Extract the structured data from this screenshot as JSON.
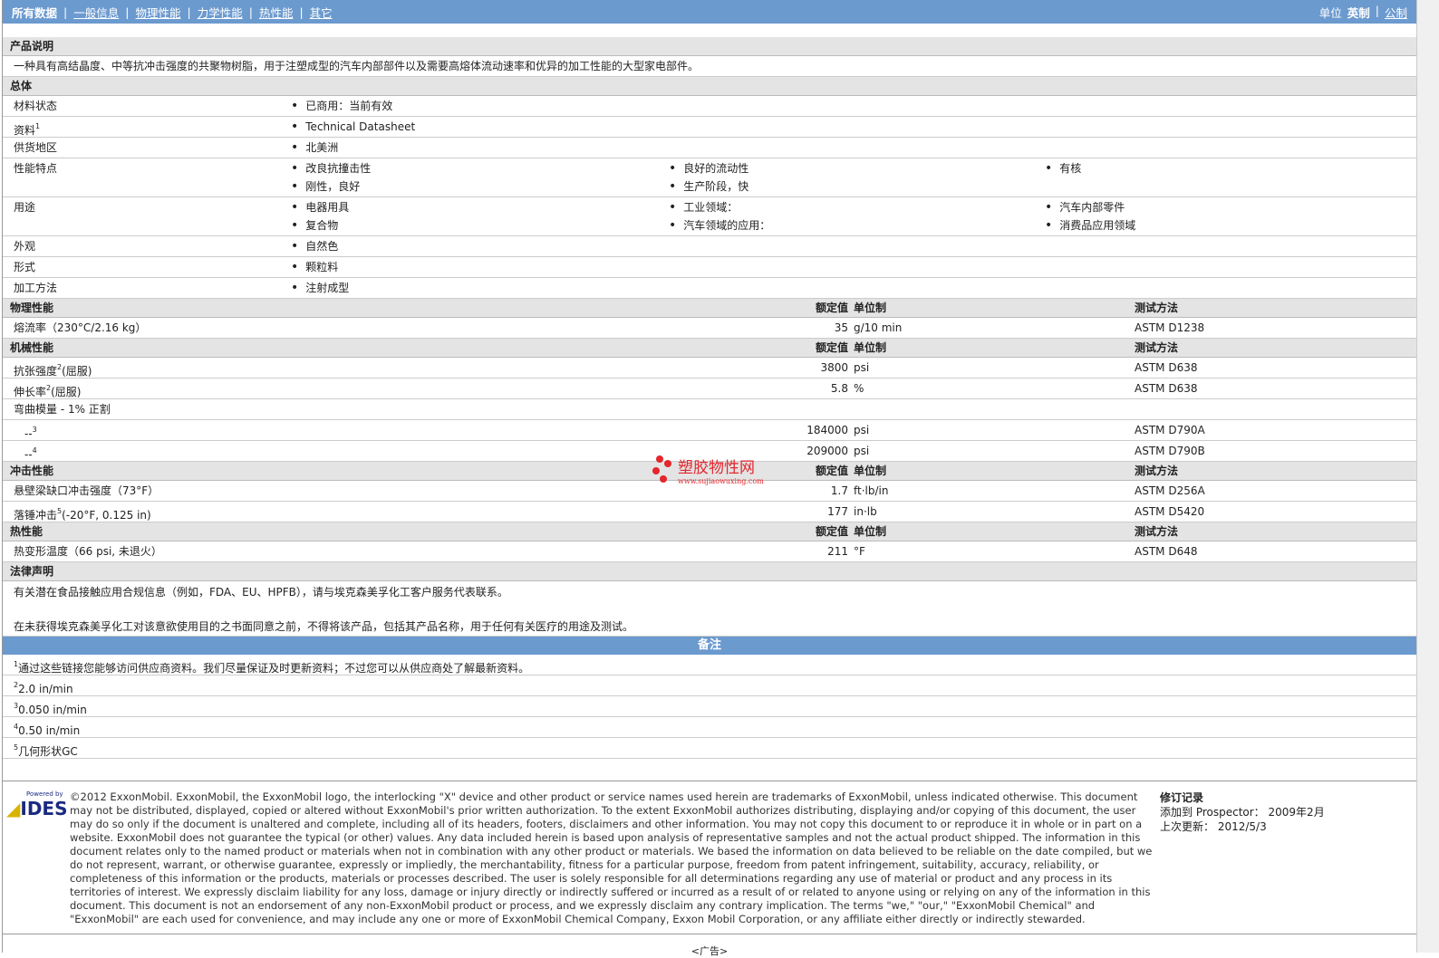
{
  "nav": {
    "tabs": [
      "所有数据",
      "一般信息",
      "物理性能",
      "力学性能",
      "热性能",
      "其它"
    ],
    "unit_label": "单位",
    "unit_imperial": "英制",
    "unit_metric": "公制"
  },
  "description": {
    "title": "产品说明",
    "text": "一种具有高结晶度、中等抗冲击强度的共聚物树脂，用于注塑成型的汽车内部部件以及需要高熔体流动速率和优异的加工性能的大型家电部件。"
  },
  "general": {
    "title": "总体",
    "rows": [
      {
        "label": "材料状态",
        "items": [
          "已商用：当前有效"
        ]
      },
      {
        "label": "资料",
        "sup": "1",
        "items": [
          "Technical Datasheet"
        ],
        "link": true
      },
      {
        "label": "供货地区",
        "items": [
          "北美洲"
        ]
      },
      {
        "label": "性能特点",
        "items": [
          "改良抗撞击性",
          "良好的流动性",
          "有核",
          "刚性，良好",
          "生产阶段，快"
        ]
      },
      {
        "label": "用途",
        "items": [
          "电器用具",
          "工业领域：",
          "汽车内部零件",
          "复合物",
          "汽车领域的应用：",
          "消费品应用领域"
        ]
      },
      {
        "label": "外观",
        "items": [
          "自然色"
        ]
      },
      {
        "label": "形式",
        "items": [
          "颗粒料"
        ]
      },
      {
        "label": "加工方法",
        "items": [
          "注射成型"
        ]
      }
    ]
  },
  "col_headers": {
    "value": "额定值",
    "unit": "单位制",
    "test": "测试方法"
  },
  "sections": [
    {
      "title": "物理性能",
      "rows": [
        {
          "label": "熔流率（230°C/2.16 kg）",
          "value": "35",
          "unit": "g/10 min",
          "test": "ASTM D1238"
        }
      ]
    },
    {
      "title": "机械性能",
      "rows": [
        {
          "label": "抗张强度",
          "sup": "2",
          "suffix": "(屈服)",
          "value": "3800",
          "unit": "psi",
          "test": "ASTM D638"
        },
        {
          "label": "伸长率",
          "sup": "2",
          "suffix": "(屈服)",
          "value": "5.8",
          "unit": "%",
          "test": "ASTM D638"
        },
        {
          "label": "弯曲模量 - 1% 正割"
        },
        {
          "label": "--",
          "sup": "3",
          "value": "184000",
          "unit": "psi",
          "test": "ASTM D790A",
          "indent": true
        },
        {
          "label": "--",
          "sup": "4",
          "value": "209000",
          "unit": "psi",
          "test": "ASTM D790B",
          "indent": true
        }
      ]
    },
    {
      "title": "冲击性能",
      "rows": [
        {
          "label": "悬壁梁缺口冲击强度（73°F）",
          "value": "1.7",
          "unit": "ft·lb/in",
          "test": "ASTM D256A"
        },
        {
          "label": "落锤冲击",
          "sup": "5",
          "suffix": "(-20°F, 0.125 in)",
          "value": "177",
          "unit": "in·lb",
          "test": "ASTM D5420"
        }
      ]
    },
    {
      "title": "热性能",
      "rows": [
        {
          "label": "热变形温度（66 psi, 未退火）",
          "value": "211",
          "unit": "°F",
          "test": "ASTM D648"
        }
      ]
    }
  ],
  "legal": {
    "title": "法律声明",
    "lines": [
      "有关潜在食品接触应用合规信息（例如，FDA、EU、HPFB），请与埃克森美孚化工客户服务代表联系。",
      "在未获得埃克森美孚化工对该意欲使用目的之书面同意之前，不得将该产品，包括其产品名称，用于任何有关医疗的用途及测试。"
    ]
  },
  "notes": {
    "title": "备注",
    "items": [
      {
        "n": "1",
        "text": "通过这些链接您能够访问供应商资料。我们尽量保证及时更新资料；不过您可以从供应商处了解最新资料。"
      },
      {
        "n": "2",
        "text": "2.0 in/min"
      },
      {
        "n": "3",
        "text": "0.050 in/min"
      },
      {
        "n": "4",
        "text": "0.50 in/min"
      },
      {
        "n": "5",
        "text": "几何形状GC"
      }
    ]
  },
  "watermark": {
    "name": "塑胶物性网",
    "url": "www.sujiaowuxing.com"
  },
  "footer": {
    "logo_powered": "Powered by",
    "logo": "IDES",
    "copyright": "©2012 ExxonMobil. ExxonMobil, the ExxonMobil logo, the interlocking \"X\" device and other product or service names used herein are trademarks of ExxonMobil, unless indicated otherwise. This document may not be distributed, displayed, copied or altered without ExxonMobil's prior written authorization. To the extent ExxonMobil authorizes distributing, displaying and/or copying of this document, the user may do so only if the document is unaltered and complete, including all of its headers, footers, disclaimers and other information. You may not copy this document to or reproduce it in whole or in part on a website. ExxonMobil does not guarantee the typical (or other) values. Any data included herein is based upon analysis of representative samples and not the actual product shipped. The information in this document relates only to the named product or materials when not in combination with any other product or materials. We based the information on data believed to be reliable on the date compiled, but we do not represent, warrant, or otherwise guarantee, expressly or impliedly, the merchantability, fitness for a particular purpose, freedom from patent infringement, suitability, accuracy, reliability, or completeness of this information or the products, materials or processes described. The user is solely responsible for all determinations regarding any use of material or product and any process in its territories of interest. We expressly disclaim liability for any loss, damage or injury directly or indirectly suffered or incurred as a result of or related to anyone using or relying on any of the information in this document. This document is not an endorsement of any non-ExxonMobil product or process, and we expressly disclaim any contrary implication. The terms \"we,\" \"our,\" \"ExxonMobil Chemical\" and \"ExxonMobil\" are each used for convenience, and may include any one or more of ExxonMobil Chemical Company, Exxon Mobil Corporation, or any affiliate either directly or indirectly stewarded.",
    "rev_title": "修订记录",
    "added_label": "添加到 Prospector：",
    "added_value": "2009年2月",
    "updated_label": "上次更新：",
    "updated_value": "2012/5/3"
  },
  "ad": "<广告>"
}
